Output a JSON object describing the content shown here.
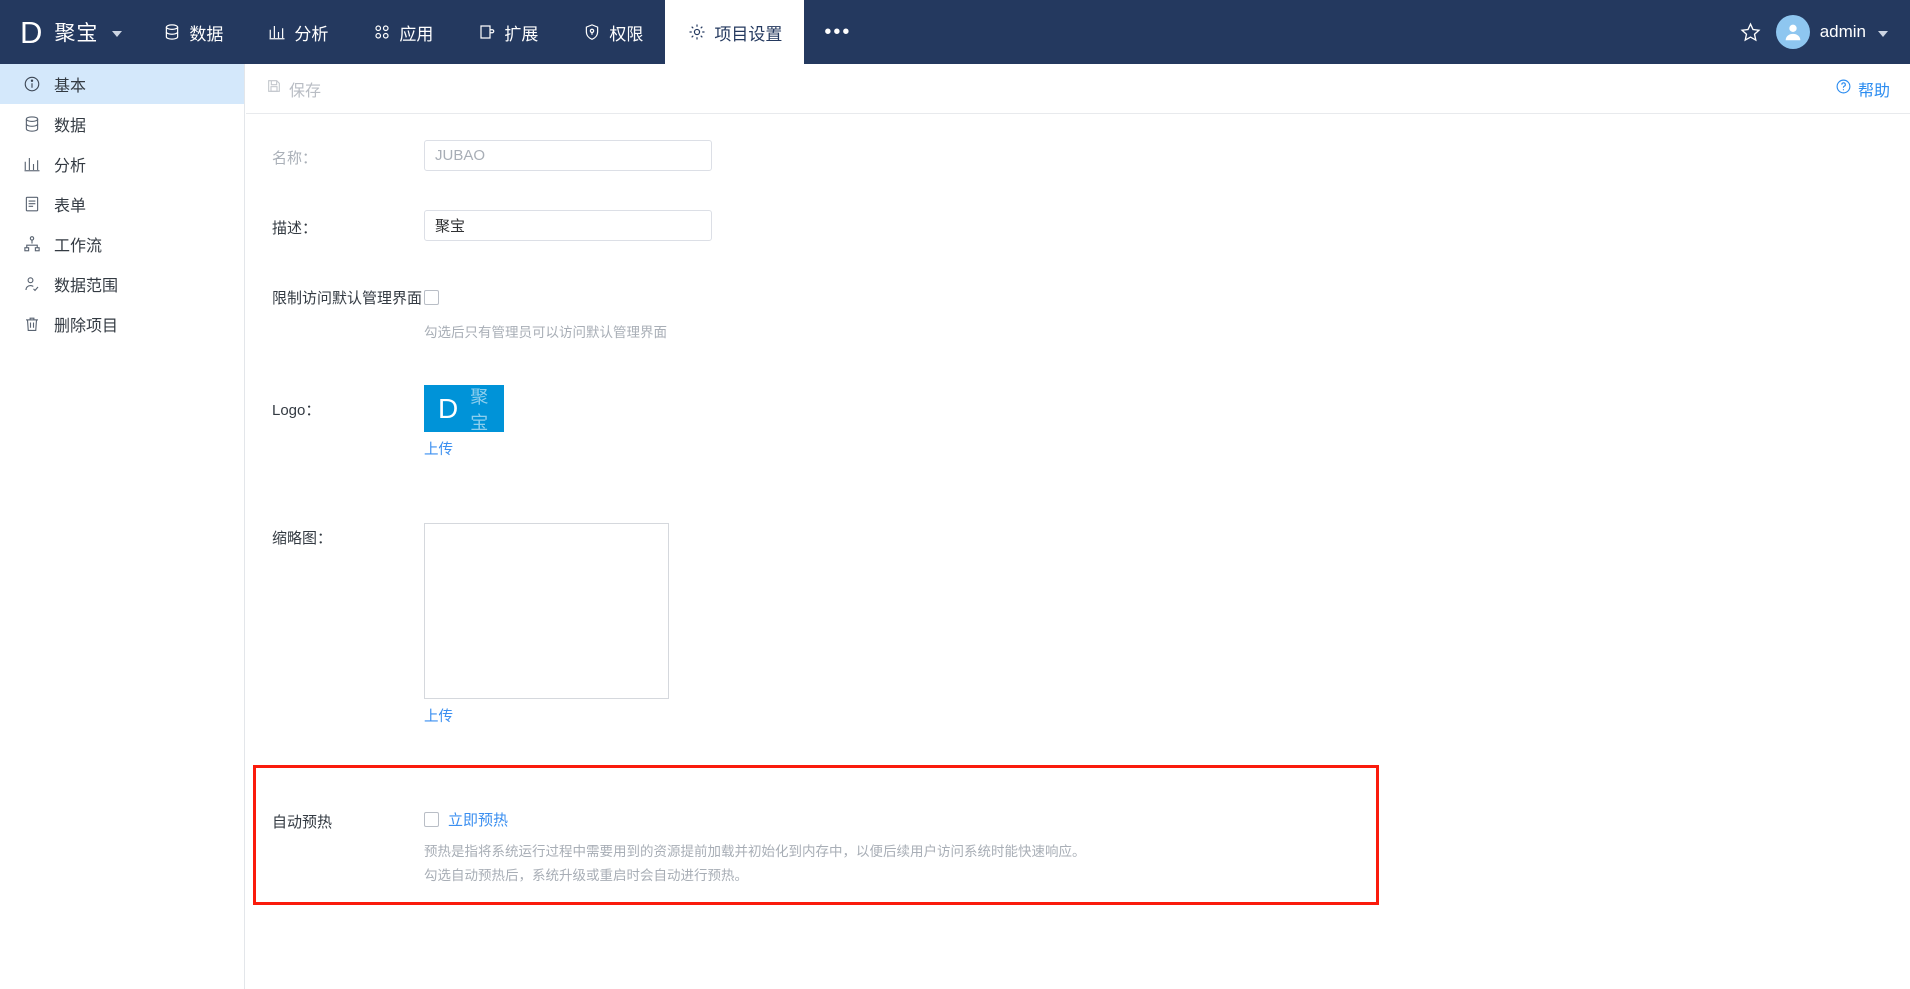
{
  "topnav": {
    "brand": {
      "letter": "D",
      "name": "聚宝",
      "caret_icon": "chevron-down-icon"
    },
    "items": [
      {
        "icon": "database-icon",
        "label": "数据",
        "active": false
      },
      {
        "icon": "bar-chart-icon",
        "label": "分析",
        "active": false
      },
      {
        "icon": "apps-grid-icon",
        "label": "应用",
        "active": false
      },
      {
        "icon": "extension-icon",
        "label": "扩展",
        "active": false
      },
      {
        "icon": "shield-icon",
        "label": "权限",
        "active": false
      },
      {
        "icon": "gear-icon",
        "label": "项目设置",
        "active": true
      }
    ],
    "more_label": "•••",
    "star_icon": "star-icon",
    "avatar_icon": "user-avatar-icon",
    "username": "admin",
    "user_caret_icon": "chevron-down-icon",
    "bg_color": "#24395f"
  },
  "sidebar": {
    "items": [
      {
        "icon": "info-circle-icon",
        "label": "基本",
        "active": true
      },
      {
        "icon": "database-icon",
        "label": "数据",
        "active": false
      },
      {
        "icon": "bar-chart-icon",
        "label": "分析",
        "active": false
      },
      {
        "icon": "form-icon",
        "label": "表单",
        "active": false
      },
      {
        "icon": "workflow-icon",
        "label": "工作流",
        "active": false
      },
      {
        "icon": "data-scope-icon",
        "label": "数据范围",
        "active": false
      },
      {
        "icon": "trash-icon",
        "label": "删除项目",
        "active": false
      }
    ],
    "active_bg": "#d4e8fb"
  },
  "toolbar": {
    "save_label": "保存",
    "save_icon": "save-disk-icon",
    "save_disabled": true,
    "help_label": "帮助",
    "help_icon": "question-circle-icon",
    "help_color": "#2b8cf0"
  },
  "form": {
    "name": {
      "label": "名称：",
      "value": "JUBAO",
      "disabled": true
    },
    "description": {
      "label": "描述：",
      "value": "聚宝",
      "disabled": false
    },
    "restrict_admin": {
      "label": "限制访问默认管理界面",
      "checked": false,
      "hint": "勾选后只有管理员可以访问默认管理界面"
    },
    "logo": {
      "label": "Logo：",
      "letter": "D",
      "word": "聚宝",
      "bg_color": "#0093d8",
      "upload_label": "上传"
    },
    "thumbnail": {
      "label": "缩略图：",
      "upload_label": "上传"
    },
    "auto_warmup": {
      "label": "自动预热",
      "checkbox_checked": false,
      "link_label": "立即预热",
      "hint_line1": "预热是指将系统运行过程中需要用到的资源提前加载并初始化到内存中，以便后续用户访问系统时能快速响应。",
      "hint_line2": "勾选自动预热后，系统升级或重启时会自动进行预热。",
      "highlight_color": "#fa1b0c"
    }
  }
}
